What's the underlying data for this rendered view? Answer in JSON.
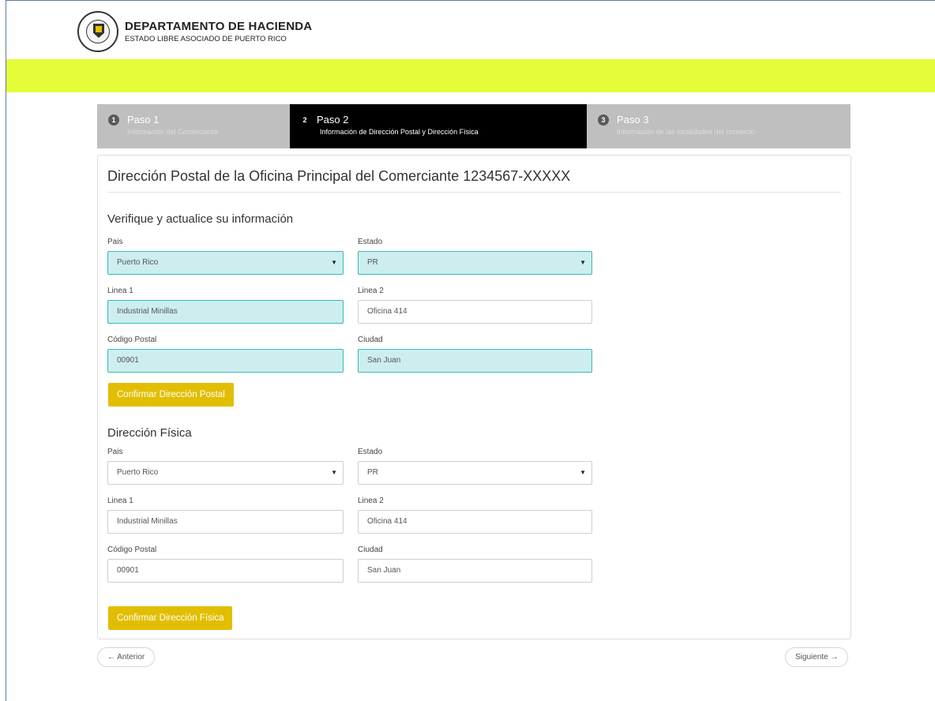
{
  "header": {
    "title": "DEPARTAMENTO DE HACIENDA",
    "subtitle": "ESTADO LIBRE ASOCIADO DE PUERTO RICO"
  },
  "steps": [
    {
      "num": "1",
      "title": "Paso 1",
      "desc": "Información del Comerciante"
    },
    {
      "num": "2",
      "title": "Paso 2",
      "desc": "Información de Dirección Postal y Dirección Física"
    },
    {
      "num": "3",
      "title": "Paso 3",
      "desc": "Información de las localidades del comercio"
    }
  ],
  "panel": {
    "title": "Dirección Postal de la Oficina Principal del Comerciante 1234567-XXXXX"
  },
  "postal": {
    "section_title": "Verifique y actualice su información",
    "pais_label": "Pais",
    "pais_value": "Puerto Rico",
    "estado_label": "Estado",
    "estado_value": "PR",
    "linea1_label": "Linea 1",
    "linea1_value": "Industrial Minillas",
    "linea2_label": "Linea 2",
    "linea2_value": "Oficina 414",
    "codigo_label": "Código Postal",
    "codigo_value": "00901",
    "ciudad_label": "Ciudad",
    "ciudad_value": "San Juan",
    "confirm_label": "Confirmar Dirección Postal"
  },
  "fisica": {
    "section_title": "Dirección Física",
    "pais_label": "Pais",
    "pais_value": "Puerto Rico",
    "estado_label": "Estado",
    "estado_value": "PR",
    "linea1_label": "Linea 1",
    "linea1_value": "Industrial Minillas",
    "linea2_label": "Linea 2",
    "linea2_value": "Oficina 414",
    "codigo_label": "Código Postal",
    "codigo_value": "00901",
    "ciudad_label": "Ciudad",
    "ciudad_value": "San Juan",
    "confirm_label": "Confirmar Dirección Física"
  },
  "pager": {
    "prev_label": "← Anterior",
    "next_label": "Siguiente →"
  },
  "icons": {
    "caret": "▼"
  },
  "colors": {
    "accent_yellow": "#e4fc3a",
    "button_gold": "#e2be02",
    "filled_field": "#cdeeee",
    "filled_border": "#3ab8b0",
    "active_step": "#000000",
    "inactive_step": "#bfbfbf"
  }
}
